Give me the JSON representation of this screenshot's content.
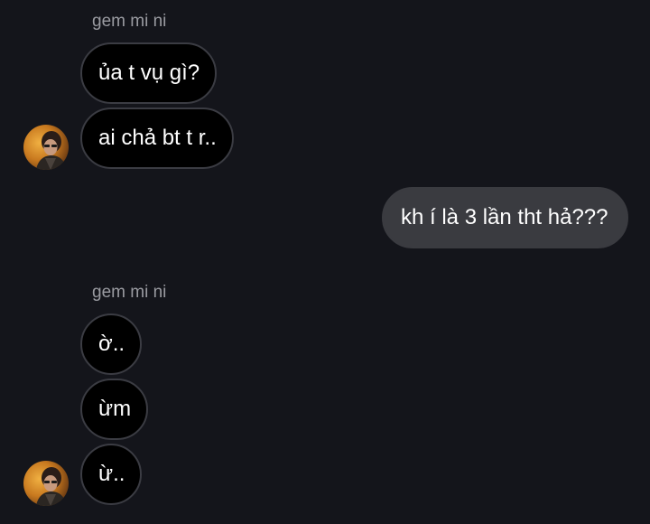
{
  "thread": {
    "group1": {
      "sender": "gem mi ni",
      "messages": [
        "ủa t vụ gì?",
        "ai chả bt t r.."
      ]
    },
    "outgoing": {
      "messages": [
        "kh í là 3 lần tht hả???"
      ]
    },
    "group2": {
      "sender": "gem mi ni",
      "messages": [
        "ờ..",
        "ừm",
        "ừ.."
      ]
    }
  },
  "colors": {
    "background": "#14151b",
    "incoming_bubble": "#000000",
    "incoming_border": "#3b3c43",
    "outgoing_bubble": "#3a3b40",
    "sender_name": "#9a9ba1",
    "text": "#ffffff"
  },
  "icons": {
    "avatar": "user-avatar-photo"
  }
}
